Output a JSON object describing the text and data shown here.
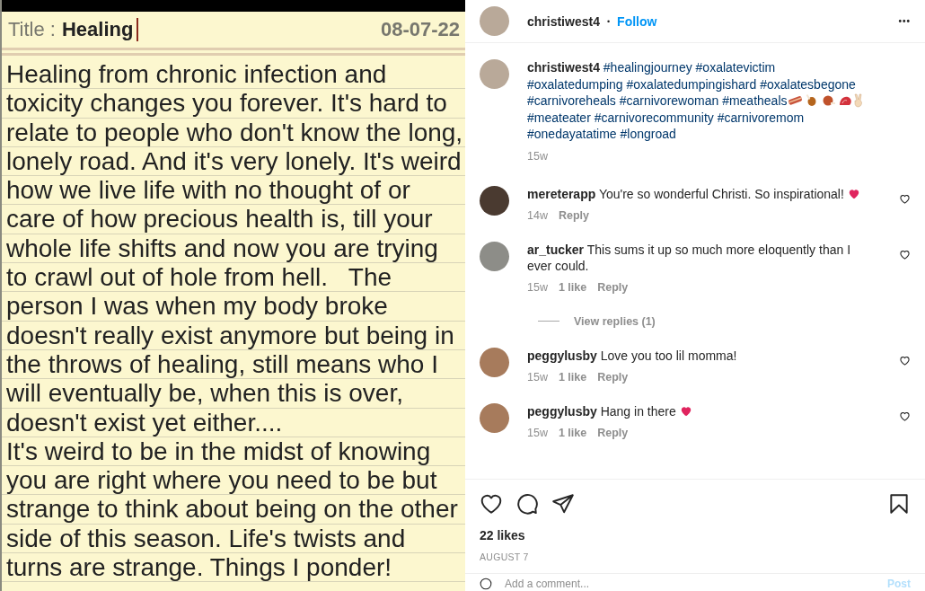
{
  "note": {
    "title_label": "Title :",
    "title": "Healing",
    "date": "08-07-22",
    "cursor": true,
    "lines": [
      "Healing from chronic infection and",
      "toxicity changes you forever. It's hard to",
      "relate to people who don't know the long,",
      "lonely road. And it's very lonely. It's weird",
      "how we live life with no thought of or",
      "care of how precious health is, till your",
      "whole life shifts and now you are trying",
      "to crawl out of hole from hell.   The",
      "person I was when my body broke",
      "doesn't really exist anymore but being in",
      "the throws of healing, still means who I",
      "will eventually be, when this is over,",
      "doesn't exist yet either....",
      "It's weird to be in the midst of knowing",
      "you are right where you need to be but",
      "strange to think about being on the other",
      "side of this season. Life's twists and",
      "turns are strange. Things I ponder!"
    ]
  },
  "post": {
    "header": {
      "username": "christiwest4",
      "separator": "•",
      "follow": "Follow",
      "more": "•••"
    },
    "caption": {
      "username": "christiwest4",
      "hashtags": [
        "#healingjourney",
        "#oxalatevictim",
        "#oxalatedumping",
        "#oxalatedumpingishard",
        "#oxalatesbegone",
        "#carnivoreheals",
        "#carnivorewoman",
        "#meatheals",
        "#meateater",
        "#carnivorecommunity",
        "#carnivoremom",
        "#onedayatatime",
        "#longroad"
      ],
      "age": "15w"
    },
    "comments": [
      {
        "username": "mereterapp",
        "text": "You're so wonderful Christi. So inspirational!",
        "heart_emoji": true,
        "age": "14w",
        "reply": "Reply"
      },
      {
        "username": "ar_tucker",
        "text": "This sums it up so much more eloquently than I ever could.",
        "heart_emoji": false,
        "age": "15w",
        "likes": "1 like",
        "reply": "Reply",
        "view_replies": "View replies (1)"
      },
      {
        "username": "peggylusby",
        "text": "Love you too lil momma!",
        "heart_emoji": false,
        "age": "15w",
        "likes": "1 like",
        "reply": "Reply"
      },
      {
        "username": "peggylusby",
        "text": "Hang in there",
        "heart_emoji": true,
        "age": "15w",
        "likes": "1 like",
        "reply": "Reply"
      }
    ],
    "likes": "22 likes",
    "date": "AUGUST 7",
    "comment_box": {
      "placeholder": "Add a comment...",
      "post": "Post"
    }
  }
}
